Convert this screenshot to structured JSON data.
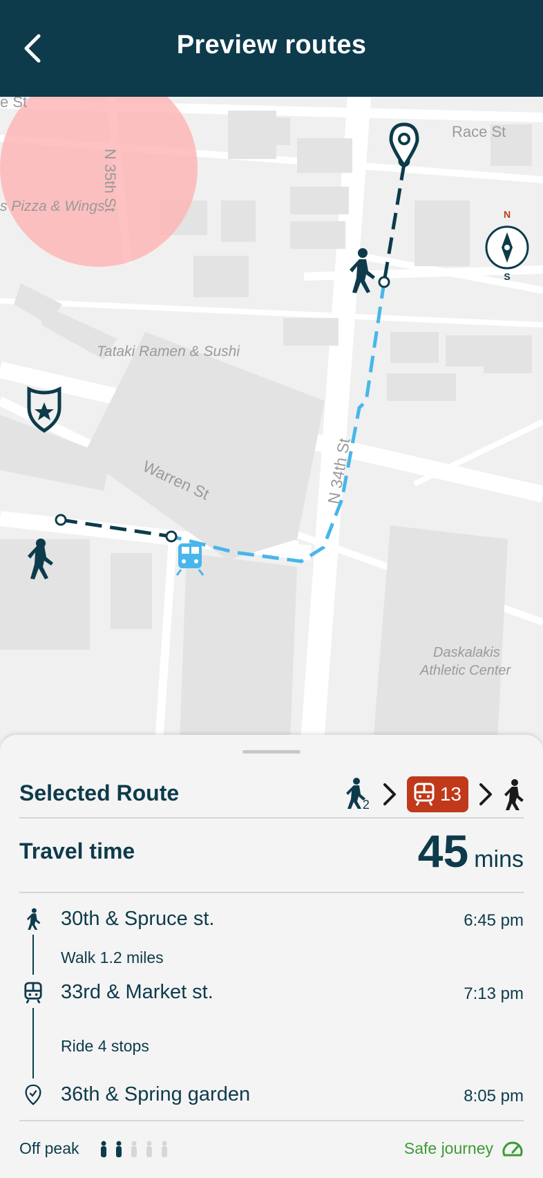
{
  "header": {
    "title": "Preview routes",
    "back_icon": "chevron-left-icon"
  },
  "map": {
    "labels": {
      "street_35": "N 35th St",
      "street_34": "N 34th St",
      "street_warren": "Warren St",
      "street_race": "Race St",
      "street_partial": "e St",
      "poi_pizza": "s Pizza & Wings",
      "poi_ramen": "Tataki Ramen & Sushi",
      "poi_athletic_1": "Daskalakis",
      "poi_athletic_2": "Athletic Center"
    },
    "compass": {
      "n": "N",
      "s": "S"
    },
    "colors": {
      "walk_line": "#0d3b4b",
      "transit_line": "#48b6ea",
      "danger_zone": "#ffb3b3"
    }
  },
  "sheet": {
    "selected_route_label": "Selected Route",
    "walk_subscript": "2",
    "train_badge": "13",
    "travel_time_label": "Travel time",
    "travel_time_value": "45",
    "travel_time_unit": "mins",
    "steps": [
      {
        "icon": "walk-icon",
        "place": "30th & Spruce st.",
        "time": "6:45 pm"
      },
      {
        "icon": "train-icon",
        "place": "33rd & Market st.",
        "time": "7:13 pm"
      },
      {
        "icon": "destination-pin-icon",
        "place": "36th & Spring garden",
        "time": "8:05 pm"
      }
    ],
    "segments": [
      "Walk 1.2 miles",
      "Ride 4 stops"
    ],
    "crowd_label": "Off peak",
    "crowd_level": "2 of 5",
    "safety_label": "Safe journey",
    "colors": {
      "primary": "#0d3b4b",
      "badge": "#c0391b",
      "safe": "#3d9a34"
    }
  }
}
